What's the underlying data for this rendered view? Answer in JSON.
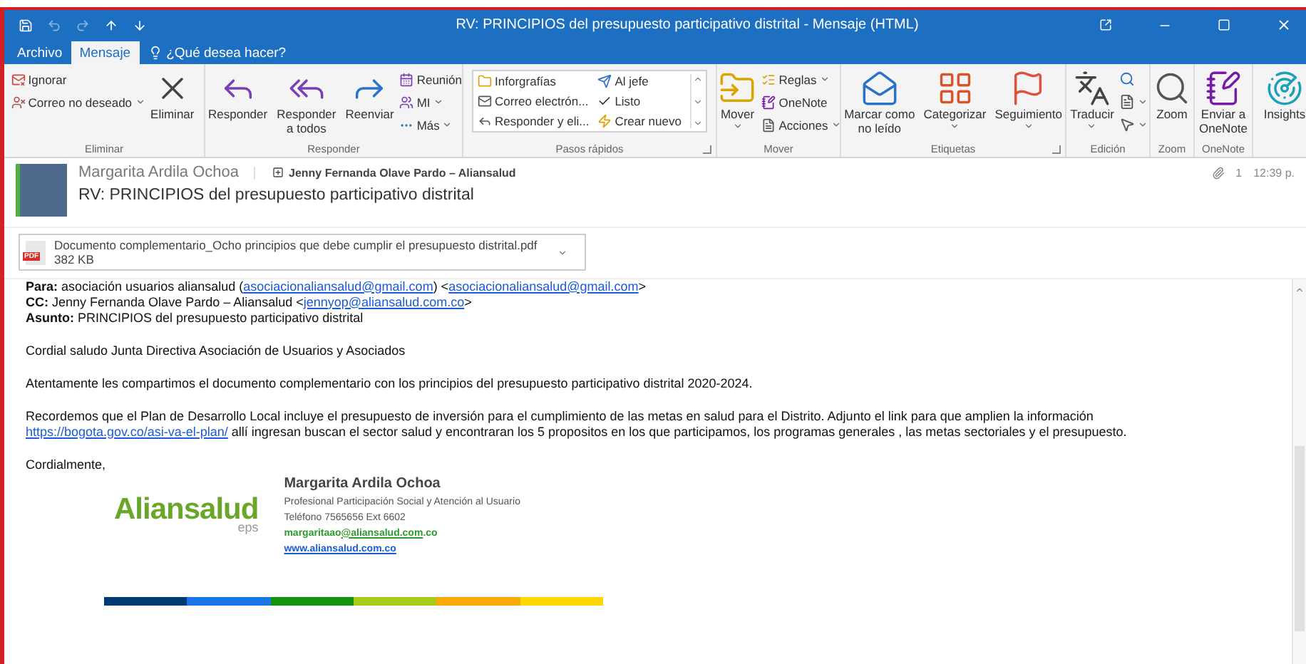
{
  "window": {
    "title": "RV: PRINCIPIOS del presupuesto participativo distrital - Mensaje (HTML)"
  },
  "tabs": [
    {
      "label": "Archivo",
      "selected": false
    },
    {
      "label": "Mensaje",
      "selected": true
    }
  ],
  "tell_me": {
    "placeholder": "¿Qué desea hacer?"
  },
  "ribbon": {
    "groups": [
      {
        "label": "Eliminar",
        "kind": "buttons",
        "launcher": false,
        "items": [
          {
            "kind": "small",
            "label": "Ignorar",
            "dropdown": false
          },
          {
            "kind": "small",
            "label": "Correo no deseado",
            "dropdown": true
          },
          {
            "kind": "large",
            "label": "Eliminar",
            "dropdown": false
          }
        ]
      },
      {
        "label": "Responder",
        "kind": "buttons",
        "launcher": false,
        "items": [
          {
            "kind": "large",
            "label": "Responder",
            "dropdown": false
          },
          {
            "kind": "large",
            "label": "Responder a todos",
            "dropdown": false
          },
          {
            "kind": "large",
            "label": "Reenviar",
            "dropdown": false
          },
          {
            "kind": "small",
            "label": "Reunión",
            "dropdown": false
          },
          {
            "kind": "small",
            "label": "MI",
            "dropdown": true
          },
          {
            "kind": "small",
            "label": "Más",
            "dropdown": true
          }
        ]
      },
      {
        "label": "Pasos rápidos",
        "kind": "gallery",
        "launcher": true,
        "items": [
          {
            "kind": "small",
            "label": "Inforgrafías",
            "dropdown": false
          },
          {
            "kind": "small",
            "label": "Correo electrón...",
            "dropdown": false
          },
          {
            "kind": "small",
            "label": "Responder y eli...",
            "dropdown": false
          },
          {
            "kind": "small",
            "label": "Al jefe",
            "dropdown": false
          },
          {
            "kind": "small",
            "label": "Listo",
            "dropdown": false
          },
          {
            "kind": "small",
            "label": "Crear nuevo",
            "dropdown": false
          }
        ]
      },
      {
        "label": "Mover",
        "kind": "buttons",
        "launcher": false,
        "items": [
          {
            "kind": "large",
            "label": "Mover",
            "dropdown": true
          },
          {
            "kind": "small",
            "label": "Reglas",
            "dropdown": true
          },
          {
            "kind": "small",
            "label": "OneNote",
            "dropdown": false
          },
          {
            "kind": "small",
            "label": "Acciones",
            "dropdown": true
          }
        ]
      },
      {
        "label": "Etiquetas",
        "kind": "buttons",
        "launcher": true,
        "items": [
          {
            "kind": "large",
            "label": "Marcar como no leído",
            "dropdown": false
          },
          {
            "kind": "large",
            "label": "Categorizar",
            "dropdown": true
          },
          {
            "kind": "large",
            "label": "Seguimiento",
            "dropdown": true
          }
        ]
      },
      {
        "label": "Edición",
        "kind": "buttons",
        "launcher": false,
        "items": [
          {
            "kind": "large",
            "label": "Traducir",
            "dropdown": true
          },
          {
            "kind": "icon",
            "dropdown": false
          },
          {
            "kind": "icon",
            "dropdown": true
          },
          {
            "kind": "icon",
            "dropdown": true
          }
        ]
      },
      {
        "label": "Zoom",
        "kind": "buttons",
        "launcher": false,
        "items": [
          {
            "kind": "large",
            "label": "Zoom",
            "dropdown": false
          }
        ]
      },
      {
        "label": "OneNote",
        "kind": "buttons",
        "launcher": false,
        "items": [
          {
            "kind": "large",
            "label": "Enviar a OneNote",
            "dropdown": false
          }
        ]
      },
      {
        "kind": "buttons",
        "launcher": false,
        "items": [
          {
            "kind": "large",
            "label": "Insights",
            "dropdown": false
          }
        ]
      }
    ]
  },
  "message": {
    "sender": "Margarita Ardila Ochoa",
    "recipient": "Jenny Fernanda Olave Pardo – Aliansalud",
    "subject": "RV: PRINCIPIOS del presupuesto participativo distrital",
    "attachment_count": "1",
    "time": "12:39 p.",
    "attachment": {
      "name": "Documento complementario_Ocho principios que debe cumplir el presupuesto distrital.pdf",
      "size": "382 KB",
      "type": "PDF"
    }
  },
  "body": {
    "header_lines": [
      {
        "label": "Para:",
        "parts": [
          {
            "text": "asociación usuarios aliansalud ("
          },
          {
            "link": "asociacionaliansalud@gmail.com"
          },
          {
            "text": ") <"
          },
          {
            "link": "asociacionaliansalud@gmail.com"
          },
          {
            "text": ">"
          }
        ]
      },
      {
        "label": "CC:",
        "parts": [
          {
            "text": "Jenny Fernanda Olave Pardo – Aliansalud <"
          },
          {
            "link": "jennyop@aliansalud.com.co"
          },
          {
            "text": ">"
          }
        ]
      },
      {
        "label": "Asunto:",
        "parts": [
          {
            "text": "PRINCIPIOS del presupuesto participativo distrital"
          }
        ]
      }
    ],
    "paragraphs": [
      [
        [
          {
            "text": "Cordial saludo Junta Directiva Asociación de Usuarios y Asociados"
          }
        ]
      ],
      [
        [
          {
            "text": "Atentamente les compartimos  el documento complementario con los principios del  presupuesto participativo distrital 2020-2024."
          }
        ]
      ],
      [
        [
          {
            "text": "Recordemos que el Plan de Desarrollo Local incluye el presupuesto de inversión para el cumplimiento de las metas en salud para el Distrito. Adjunto el link para que amplien la información"
          }
        ],
        [
          {
            "link": "https://bogota.gov.co/asi-va-el-plan/"
          },
          {
            "text": " allí ingresan buscan el sector salud y encontraran los 5 propositos  en los que participamos, los programas generales , las metas sectoriales y el presupuesto."
          }
        ]
      ],
      [
        [
          {
            "text": "Cordialmente,"
          }
        ]
      ]
    ],
    "signature": {
      "logo": "Aliansalud",
      "logo_sub": "eps",
      "name": "Margarita Ardila Ochoa",
      "role": "Profesional Participación Social y Atención al Usuario",
      "phone": "Teléfono 7565656 Ext 6602",
      "email_user": "margaritaao",
      "email_link": "@aliansalud.com",
      "email_end": ".co",
      "website": "www.aliansalud.com.co",
      "stripe": [
        {
          "color": "#003b73"
        },
        {
          "color": "#1a75e6"
        },
        {
          "color": "#13940f"
        },
        {
          "color": "#a8cb1a"
        },
        {
          "color": "#f9aa05"
        },
        {
          "color": "#fed600"
        }
      ]
    }
  }
}
